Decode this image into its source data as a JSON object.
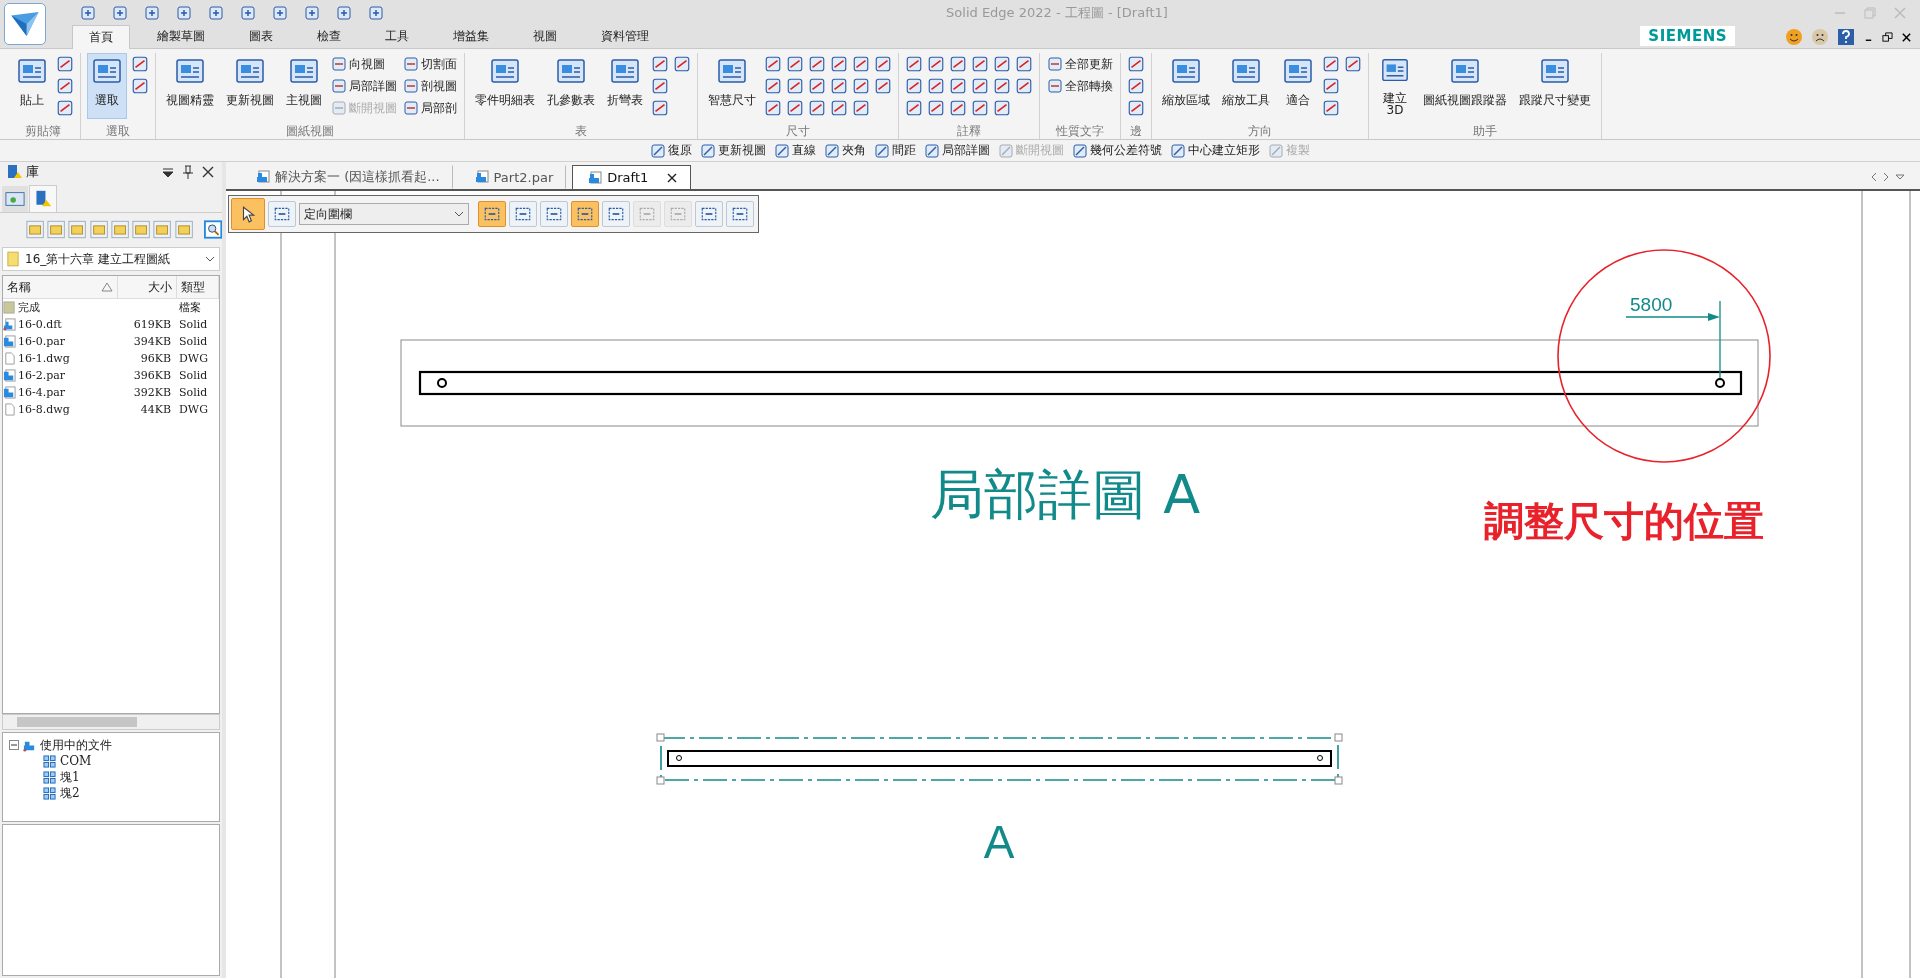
{
  "app": {
    "title": "Solid Edge 2022 - 工程圖 - [Draft1]",
    "brand": "SIEMENS"
  },
  "ribbon_tabs": [
    {
      "label": "首頁",
      "selected": true
    },
    {
      "label": "繪製草圖",
      "selected": false
    },
    {
      "label": "圖表",
      "selected": false
    },
    {
      "label": "檢查",
      "selected": false
    },
    {
      "label": "工具",
      "selected": false
    },
    {
      "label": "增益集",
      "selected": false
    },
    {
      "label": "視圖",
      "selected": false
    },
    {
      "label": "資料管理",
      "selected": false
    }
  ],
  "ribbon_groups": [
    {
      "label": "剪貼簿",
      "buttons": [
        {
          "kind": "large",
          "label": "貼上",
          "active": false
        },
        {
          "kind": "icon"
        },
        {
          "kind": "icon"
        },
        {
          "kind": "icon"
        }
      ]
    },
    {
      "label": "選取",
      "buttons": [
        {
          "kind": "large",
          "label": "選取",
          "active": true
        },
        {
          "kind": "icon"
        },
        {
          "kind": "icon"
        }
      ]
    },
    {
      "label": "圖紙視圖",
      "buttons": [
        {
          "kind": "large",
          "label": "視圖精靈",
          "active": false
        },
        {
          "kind": "large",
          "label": "更新視圖",
          "active": false
        },
        {
          "kind": "large",
          "label": "主視圖",
          "active": false
        },
        {
          "kind": "small",
          "label": "向視圖",
          "disabled": false
        },
        {
          "kind": "small",
          "label": "局部詳圖",
          "disabled": false
        },
        {
          "kind": "small",
          "label": "斷開視圖",
          "disabled": true
        },
        {
          "kind": "small",
          "label": "切割面",
          "disabled": false
        },
        {
          "kind": "small",
          "label": "剖視圖",
          "disabled": false
        },
        {
          "kind": "small",
          "label": "局部剖",
          "disabled": false
        }
      ]
    },
    {
      "label": "表",
      "buttons": [
        {
          "kind": "large",
          "label": "零件明細表",
          "active": false
        },
        {
          "kind": "large",
          "label": "孔參數表",
          "active": false
        },
        {
          "kind": "large",
          "label": "折彎表",
          "active": false
        },
        {
          "kind": "icon"
        },
        {
          "kind": "icon"
        },
        {
          "kind": "icon"
        },
        {
          "kind": "icon"
        }
      ]
    },
    {
      "label": "尺寸",
      "buttons": [
        {
          "kind": "large",
          "label": "智慧尺寸",
          "active": false
        },
        {
          "kind": "icon"
        },
        {
          "kind": "icon"
        },
        {
          "kind": "icon"
        },
        {
          "kind": "icon"
        },
        {
          "kind": "icon"
        },
        {
          "kind": "icon"
        },
        {
          "kind": "icon"
        },
        {
          "kind": "icon"
        },
        {
          "kind": "icon"
        },
        {
          "kind": "icon"
        },
        {
          "kind": "icon"
        },
        {
          "kind": "icon"
        },
        {
          "kind": "icon"
        },
        {
          "kind": "icon"
        },
        {
          "kind": "icon"
        },
        {
          "kind": "icon"
        },
        {
          "kind": "icon"
        }
      ]
    },
    {
      "label": "註釋",
      "buttons": [
        {
          "kind": "icon"
        },
        {
          "kind": "icon"
        },
        {
          "kind": "icon"
        },
        {
          "kind": "icon"
        },
        {
          "kind": "icon"
        },
        {
          "kind": "icon"
        },
        {
          "kind": "icon"
        },
        {
          "kind": "icon"
        },
        {
          "kind": "icon"
        },
        {
          "kind": "icon"
        },
        {
          "kind": "icon"
        },
        {
          "kind": "icon"
        },
        {
          "kind": "icon"
        },
        {
          "kind": "icon"
        },
        {
          "kind": "icon"
        },
        {
          "kind": "icon"
        },
        {
          "kind": "icon"
        }
      ]
    },
    {
      "label": "性質文字",
      "buttons": [
        {
          "kind": "small",
          "label": "全部更新",
          "disabled": false
        },
        {
          "kind": "small",
          "label": "全部轉換",
          "disabled": false
        }
      ]
    },
    {
      "label": "邊",
      "buttons": [
        {
          "kind": "icon"
        },
        {
          "kind": "icon"
        },
        {
          "kind": "icon"
        }
      ]
    },
    {
      "label": "方向",
      "buttons": [
        {
          "kind": "large",
          "label": "縮放區域",
          "active": false
        },
        {
          "kind": "large",
          "label": "縮放工具",
          "active": false
        },
        {
          "kind": "large",
          "label": "適合",
          "active": false
        },
        {
          "kind": "icon"
        },
        {
          "kind": "icon"
        },
        {
          "kind": "icon"
        },
        {
          "kind": "icon"
        }
      ]
    },
    {
      "label": "助手",
      "buttons": [
        {
          "kind": "large",
          "label": "建立\n3D",
          "active": false
        },
        {
          "kind": "large",
          "label": "圖紙視圖跟蹤器",
          "active": false
        },
        {
          "kind": "large",
          "label": "跟蹤尺寸變更",
          "active": false
        }
      ]
    }
  ],
  "command_bar": [
    {
      "label": "復原",
      "disabled": false
    },
    {
      "label": "更新視圖",
      "disabled": false
    },
    {
      "label": "直線",
      "disabled": false
    },
    {
      "label": "夾角",
      "disabled": false
    },
    {
      "label": "間距",
      "disabled": false
    },
    {
      "label": "局部詳圖",
      "disabled": false
    },
    {
      "label": "斷開視圖",
      "disabled": true
    },
    {
      "label": "幾何公差符號",
      "disabled": false
    },
    {
      "label": "中心建立矩形",
      "disabled": false
    },
    {
      "label": "複製",
      "disabled": true
    }
  ],
  "library_panel": {
    "title": "庫",
    "folder": "16_第十六章 建立工程圖紙",
    "columns": [
      "名稱",
      "大小",
      "類型"
    ],
    "rows": [
      {
        "kind": "folder",
        "name": "完成",
        "type": "檔案"
      },
      {
        "kind": "draft",
        "name": "16-0.dft",
        "size": "619KB",
        "type": "Solid"
      },
      {
        "kind": "part",
        "name": "16-0.par",
        "size": "394KB",
        "type": "Solid"
      },
      {
        "kind": "dwg",
        "name": "16-1.dwg",
        "size": "96KB",
        "type": "DWG"
      },
      {
        "kind": "part",
        "name": "16-2.par",
        "size": "396KB",
        "type": "Solid"
      },
      {
        "kind": "part",
        "name": "16-4.par",
        "size": "392KB",
        "type": "Solid"
      },
      {
        "kind": "dwg",
        "name": "16-8.dwg",
        "size": "44KB",
        "type": "DWG"
      }
    ]
  },
  "document_tree": {
    "label": "使用中的文件",
    "expanded": true,
    "children": [
      {
        "label": "COM"
      },
      {
        "label": "塊1"
      },
      {
        "label": "塊2"
      }
    ]
  },
  "document_tabs": [
    {
      "label": "解決方案一 (因這樣抓看起...",
      "selected": false
    },
    {
      "label": "Part2.par",
      "selected": false
    },
    {
      "label": "Draft1",
      "selected": true
    }
  ],
  "view_toolbar": [
    {
      "kind": "button",
      "active": true,
      "disabled": false
    },
    {
      "kind": "button",
      "active": false,
      "disabled": false
    },
    {
      "kind": "dropdown",
      "value": "定向圍欄"
    },
    {
      "kind": "button",
      "active": true,
      "disabled": false
    },
    {
      "kind": "button",
      "active": false,
      "disabled": false
    },
    {
      "kind": "button",
      "active": false,
      "disabled": false
    },
    {
      "kind": "button",
      "active": true,
      "disabled": false
    },
    {
      "kind": "button",
      "active": false,
      "disabled": false
    },
    {
      "kind": "button",
      "active": false,
      "disabled": true
    },
    {
      "kind": "button",
      "active": false,
      "disabled": true
    },
    {
      "kind": "button",
      "active": false,
      "disabled": false
    },
    {
      "kind": "button",
      "active": false,
      "disabled": false
    }
  ],
  "drawing": {
    "dimension": "5800",
    "detail_title": "局部詳圖 A",
    "annotation": "調整尺寸的位置",
    "view_label": "A"
  }
}
